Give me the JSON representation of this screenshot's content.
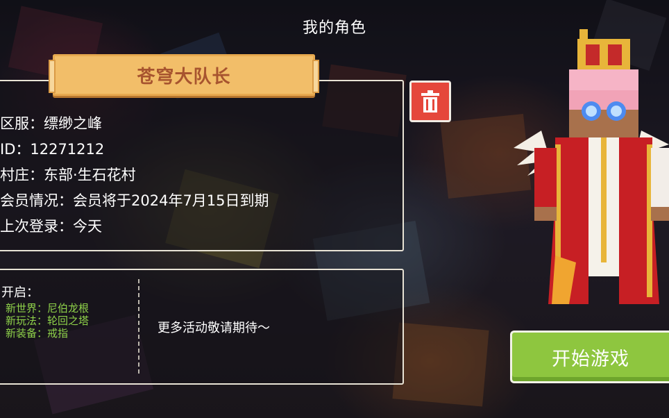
{
  "header": {
    "title": "我的角色"
  },
  "character": {
    "name": "苍穹大队长",
    "info_lines": [
      "区服：缥缈之峰",
      "ID：12271212",
      "村庄：东部·生石花村",
      "会员情况：会员将于2024年7月15日到期",
      "上次登录：今天"
    ]
  },
  "events": {
    "label": "开启：",
    "features": [
      "新世界：尼伯龙根",
      "新玩法：轮回之塔",
      "新装备：戒指"
    ],
    "more": "更多活动敬请期待～"
  },
  "buttons": {
    "start": "开始游戏"
  },
  "icons": {
    "delete": "trash-icon"
  },
  "colors": {
    "banner": "#f2be69",
    "banner_text": "#a7542f",
    "delete_button": "#e5473b",
    "start_button": "#8ec63f",
    "feature_text": "#8fd24a"
  }
}
